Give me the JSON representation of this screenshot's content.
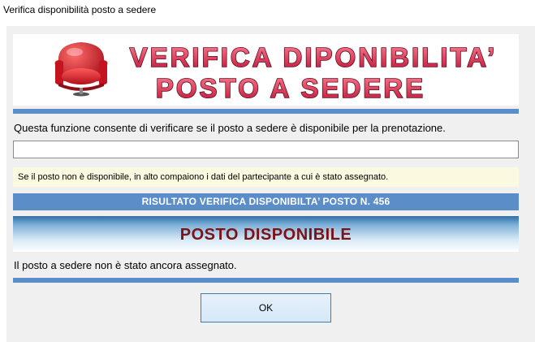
{
  "window": {
    "title": "Verifica disponibilità posto a sedere"
  },
  "banner": {
    "line1": "VERIFICA DIPONIBILITA’",
    "line2": "POSTO A SEDERE",
    "icon": "armchair-icon",
    "text_fill": "#d81e3c",
    "text_outline": "#6e1a26"
  },
  "form": {
    "description": "Questa funzione consente di verificare se il posto a sedere è disponibile per la prenotazione.",
    "seat_input_value": "",
    "hint": "Se il posto non è disponibile, in alto compaiono i dati del partecipante a cui è stato assegnato."
  },
  "result": {
    "header": "RISULTATO VERIFICA DISPONIBILTA’ POSTO N.  456",
    "status": "POSTO DISPONIBILE",
    "message": "Il posto a sedere non è stato ancora assegnato."
  },
  "buttons": {
    "ok_label": "OK"
  },
  "colors": {
    "accent_bar": "#5b8ec9",
    "status_text": "#7b1214",
    "hint_background": "#fbfae0"
  }
}
